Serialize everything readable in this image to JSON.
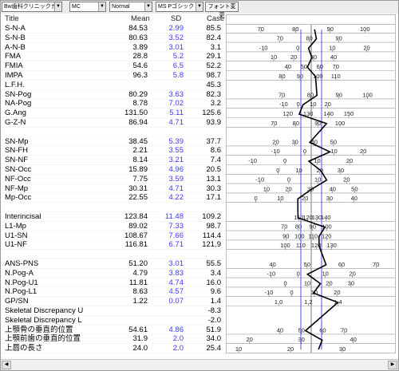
{
  "toolbar": {
    "clinic": "Bw歯科クリニックカス",
    "item2": "MC",
    "style": "Normal",
    "font": "MS Pゴシック",
    "font_change": "フォント変更"
  },
  "header": {
    "title": "Title",
    "mean": "Mean",
    "sd": "SD",
    "case": "Case"
  },
  "colors": {
    "sd_text": "#3a3aff",
    "sd_line": "#3a3aff",
    "case_line": "#000000",
    "grid": "#999999"
  },
  "rows": [
    {
      "label": "S-N-A",
      "mean": "84.53",
      "sd": "2.99",
      "case": "85.5",
      "m": 84.53,
      "s": 2.99,
      "c": 85.5,
      "ticks": [
        "70",
        "80",
        "90",
        "100"
      ],
      "tickvals": [
        70,
        80,
        90,
        100
      ]
    },
    {
      "label": "S-N-B",
      "mean": "80.63",
      "sd": "3.52",
      "sd_v": 3.52,
      "case": "82.4",
      "m": 80.63,
      "s": 3.52,
      "c": 82.4,
      "ticks": [
        "70",
        "80",
        "90"
      ],
      "tickvals": [
        70,
        80,
        90
      ]
    },
    {
      "label": "A-N-B",
      "mean": "3.89",
      "sd": "3.01",
      "case": "3.1",
      "m": 3.89,
      "s": 3.01,
      "c": 3.1,
      "ticks": [
        "-10",
        "0",
        "10",
        "20"
      ],
      "tickvals": [
        -10,
        0,
        10,
        20
      ]
    },
    {
      "label": "FMA",
      "mean": "28.8",
      "sd": "5.2",
      "case": "29.1",
      "m": 28.8,
      "s": 5.2,
      "c": 29.1,
      "ticks": [
        "10",
        "20",
        "30",
        "40"
      ],
      "tickvals": [
        10,
        20,
        30,
        40
      ]
    },
    {
      "label": "FMIA",
      "mean": "54.6",
      "sd": "6.5",
      "case": "52.2",
      "m": 54.6,
      "s": 6.5,
      "c": 52.2,
      "ticks": [
        "40",
        "50",
        "60",
        "70"
      ],
      "tickvals": [
        40,
        50,
        60,
        70
      ]
    },
    {
      "label": "IMPA",
      "mean": "96.3",
      "sd": "5.8",
      "case": "98.7",
      "m": 96.3,
      "s": 5.8,
      "c": 98.7,
      "ticks": [
        "80",
        "90",
        "100",
        "110"
      ],
      "tickvals": [
        80,
        90,
        100,
        110
      ]
    },
    {
      "label": "L.F.H.",
      "mean": "",
      "sd": "",
      "case": "45.3",
      "m": null,
      "s": null,
      "c": null,
      "ticks": [],
      "tickvals": []
    },
    {
      "label": "SN-Pog",
      "mean": "80.29",
      "sd": "3.63",
      "case": "82.3",
      "m": 80.29,
      "s": 3.63,
      "c": 82.3,
      "ticks": [
        "70",
        "80",
        "90",
        "100"
      ],
      "tickvals": [
        70,
        80,
        90,
        100
      ]
    },
    {
      "label": "NA-Pog",
      "mean": "8.78",
      "sd": "7.02",
      "case": "3.2",
      "m": 8.78,
      "s": 7.02,
      "c": 3.2,
      "ticks": [
        "-10",
        "0",
        "10",
        "20"
      ],
      "tickvals": [
        -10,
        0,
        10,
        20
      ]
    },
    {
      "label": "G.Ang",
      "mean": "131.50",
      "sd": "5.11",
      "case": "125.6",
      "m": 131.5,
      "s": 5.11,
      "c": 125.6,
      "ticks": [
        "120",
        "130",
        "140",
        "150"
      ],
      "tickvals": [
        120,
        130,
        140,
        150
      ]
    },
    {
      "label": "G-Z-N",
      "mean": "86.94",
      "sd": "4.71",
      "case": "93.9",
      "m": 86.94,
      "s": 4.71,
      "c": 93.9,
      "ticks": [
        "70",
        "80",
        "90",
        "100"
      ],
      "tickvals": [
        70,
        80,
        90,
        100
      ]
    },
    {
      "label": "",
      "mean": "",
      "sd": "",
      "case": "",
      "m": null,
      "s": null,
      "c": null,
      "ticks": [],
      "tickvals": []
    },
    {
      "label": "SN-Mp",
      "mean": "38.45",
      "sd": "5.39",
      "case": "37.7",
      "m": 38.45,
      "s": 5.39,
      "c": 37.7,
      "ticks": [
        "20",
        "30",
        "40",
        "50"
      ],
      "tickvals": [
        20,
        30,
        40,
        50
      ]
    },
    {
      "label": "SN-FH",
      "mean": "2.21",
      "sd": "3.55",
      "case": "8.6",
      "m": 2.21,
      "s": 3.55,
      "c": 8.6,
      "ticks": [
        "-10",
        "0",
        "10",
        "20"
      ],
      "tickvals": [
        -10,
        0,
        10,
        20
      ]
    },
    {
      "label": "SN-NF",
      "mean": "8.14",
      "sd": "3.21",
      "case": "7.4",
      "m": 8.14,
      "s": 3.21,
      "c": 7.4,
      "ticks": [
        "-10",
        "0",
        "10",
        "20"
      ],
      "tickvals": [
        -10,
        0,
        10,
        20
      ]
    },
    {
      "label": "SN-Occ",
      "mean": "15.89",
      "sd": "4.96",
      "case": "20.5",
      "m": 15.89,
      "s": 4.96,
      "c": 20.5,
      "ticks": [
        "0",
        "10",
        "20",
        "30"
      ],
      "tickvals": [
        0,
        10,
        20,
        30
      ]
    },
    {
      "label": "NF-Occ",
      "mean": "7.75",
      "sd": "3.59",
      "case": "13.1",
      "m": 7.75,
      "s": 3.59,
      "c": 13.1,
      "ticks": [
        "-10",
        "0",
        "10",
        "20"
      ],
      "tickvals": [
        -10,
        0,
        10,
        20
      ]
    },
    {
      "label": "NF-Mp",
      "mean": "30.31",
      "sd": "4.71",
      "case": "30.3",
      "m": 30.31,
      "s": 4.71,
      "c": 30.3,
      "ticks": [
        "10",
        "20",
        "30",
        "40",
        "50"
      ],
      "tickvals": [
        10,
        20,
        30,
        40,
        50
      ]
    },
    {
      "label": "Mp-Occ",
      "mean": "22.55",
      "sd": "4.22",
      "case": "17.1",
      "m": 22.55,
      "s": 4.22,
      "c": 17.1,
      "ticks": [
        "0",
        "10",
        "20",
        "30",
        "40"
      ],
      "tickvals": [
        0,
        10,
        20,
        30,
        40
      ]
    },
    {
      "label": "",
      "mean": "",
      "sd": "",
      "case": "",
      "m": null,
      "s": null,
      "c": null,
      "ticks": [],
      "tickvals": []
    },
    {
      "label": "Interincisal",
      "mean": "123.84",
      "sd": "11.48",
      "case": "109.2",
      "m": 123.84,
      "s": 11.48,
      "c": 109.2,
      "ticks": [
        "110",
        "120",
        "130",
        "140"
      ],
      "tickvals": [
        110,
        120,
        130,
        140
      ]
    },
    {
      "label": "L1-Mp",
      "mean": "89.02",
      "sd": "7.33",
      "case": "98.7",
      "m": 89.02,
      "s": 7.33,
      "c": 98.7,
      "ticks": [
        "70",
        "80",
        "90",
        "100"
      ],
      "tickvals": [
        70,
        80,
        90,
        100
      ]
    },
    {
      "label": "U1-SN",
      "mean": "108.67",
      "sd": "7.66",
      "case": "114.4",
      "m": 108.67,
      "s": 7.66,
      "c": 114.4,
      "ticks": [
        "90",
        "100",
        "110",
        "120"
      ],
      "tickvals": [
        90,
        100,
        110,
        120
      ]
    },
    {
      "label": "U1-NF",
      "mean": "116.81",
      "sd": "6.71",
      "case": "121.9",
      "m": 116.81,
      "s": 6.71,
      "c": 121.9,
      "ticks": [
        "100",
        "110",
        "120",
        "130"
      ],
      "tickvals": [
        100,
        110,
        120,
        130
      ]
    },
    {
      "label": "",
      "mean": "",
      "sd": "",
      "case": "",
      "m": null,
      "s": null,
      "c": null,
      "ticks": [],
      "tickvals": []
    },
    {
      "label": "ANS-PNS",
      "mean": "51.20",
      "sd": "3.01",
      "case": "55.5",
      "m": 51.2,
      "s": 3.01,
      "c": 55.5,
      "ticks": [
        "40",
        "50",
        "60",
        "70"
      ],
      "tickvals": [
        40,
        50,
        60,
        70
      ]
    },
    {
      "label": "N.Pog-A",
      "mean": "4.79",
      "sd": "3.83",
      "case": "3.4",
      "m": 4.79,
      "s": 3.83,
      "c": 3.4,
      "ticks": [
        "-10",
        "0",
        "10",
        "20"
      ],
      "tickvals": [
        -10,
        0,
        10,
        20
      ]
    },
    {
      "label": "N.Pog-U1",
      "mean": "11.81",
      "sd": "4.74",
      "case": "16.0",
      "m": 11.81,
      "s": 4.74,
      "c": 16.0,
      "ticks": [
        "0",
        "10",
        "20",
        "30"
      ],
      "tickvals": [
        0,
        10,
        20,
        30
      ]
    },
    {
      "label": "N.Pog-L1",
      "mean": "8.63",
      "sd": "4.57",
      "case": "9.6",
      "m": 8.63,
      "s": 4.57,
      "c": 9.6,
      "ticks": [
        "-10",
        "0",
        "10",
        "20"
      ],
      "tickvals": [
        -10,
        0,
        10,
        20
      ]
    },
    {
      "label": "GP/SN",
      "mean": "1.22",
      "sd": "0.07",
      "case": "1.4",
      "m": 1.22,
      "s": 0.07,
      "c": 1.4,
      "ticks": [
        "1.0",
        "1.2",
        "1.4"
      ],
      "tickvals": [
        1.0,
        1.2,
        1.4
      ]
    },
    {
      "label": "Skeletal Discrepancy U",
      "mean": "",
      "sd": "",
      "case": "-8.3",
      "m": null,
      "s": null,
      "c": null,
      "ticks": [],
      "tickvals": []
    },
    {
      "label": "Skeletal Discrepancy L",
      "mean": "",
      "sd": "",
      "case": "-2.0",
      "m": null,
      "s": null,
      "c": null,
      "ticks": [],
      "tickvals": []
    },
    {
      "label": "上顎骨の垂直的位置",
      "mean": "54.61",
      "sd": "4.86",
      "case": "51.9",
      "m": 54.61,
      "s": 4.86,
      "c": 51.9,
      "ticks": [
        "40",
        "50",
        "60",
        "70"
      ],
      "tickvals": [
        40,
        50,
        60,
        70
      ]
    },
    {
      "label": "上顎前歯の垂直的位置",
      "mean": "31.9",
      "sd": "2.0",
      "case": "34.0",
      "m": 31.9,
      "s": 2.0,
      "c": 34.0,
      "ticks": [
        "20",
        "30",
        "40"
      ],
      "tickvals": [
        20,
        30,
        40
      ]
    },
    {
      "label": "上唇の長さ",
      "mean": "24.0",
      "sd": "2.0",
      "case": "25.4",
      "m": 24.0,
      "s": 2.0,
      "c": 25.4,
      "ticks": [
        "10",
        "20",
        "30",
        "40"
      ],
      "tickvals": [
        10,
        20,
        30,
        40
      ]
    }
  ]
}
